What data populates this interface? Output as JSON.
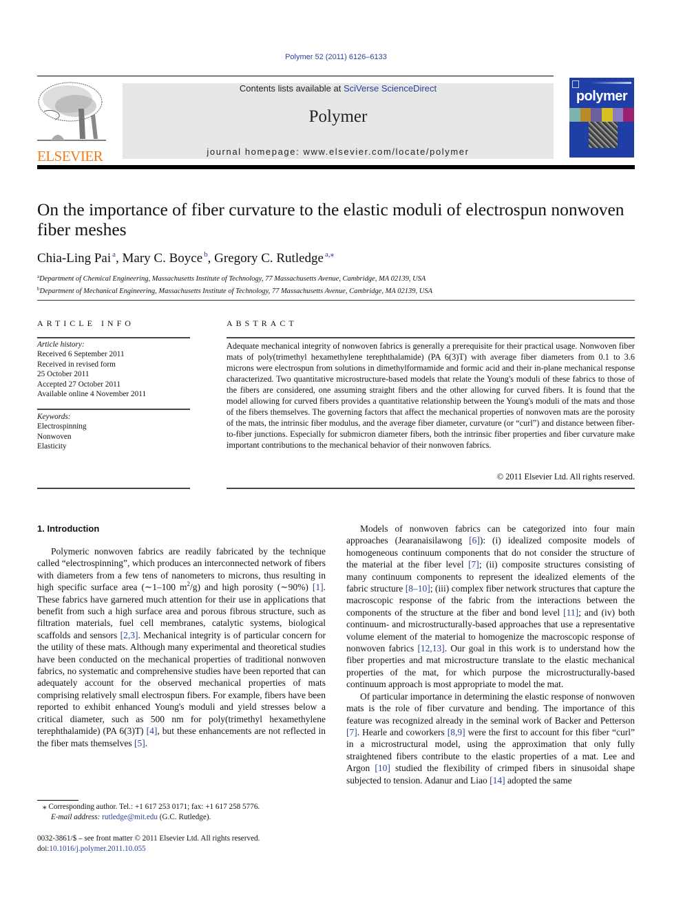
{
  "journal_ref": "Polymer 52 (2011) 6126–6133",
  "masthead": {
    "contents_prefix": "Contents lists available at ",
    "contents_link": "SciVerse ScienceDirect",
    "journal_name": "Polymer",
    "homepage": "journal homepage: www.elsevier.com/locate/polymer"
  },
  "publisher_logo": {
    "wordmark": "ELSEVIER",
    "color": "#f07c1a"
  },
  "cover": {
    "title": "polymer",
    "color": "#1f3fa7"
  },
  "article": {
    "title": "On the importance of fiber curvature to the elastic moduli of electrospun nonwoven fiber meshes",
    "authors": [
      {
        "name": "Chia-Ling Pai",
        "marks": "a"
      },
      {
        "name": "Mary C. Boyce",
        "marks": "b"
      },
      {
        "name": "Gregory C. Rutledge",
        "marks": "a,⁎"
      }
    ],
    "affiliations": [
      {
        "mark": "a",
        "text": "Department of Chemical Engineering, Massachusetts Institute of Technology, 77 Massachusetts Avenue, Cambridge, MA 02139, USA"
      },
      {
        "mark": "b",
        "text": "Department of Mechanical Engineering, Massachusetts Institute of Technology, 77 Massachusetts Avenue, Cambridge, MA 02139, USA"
      }
    ]
  },
  "article_info": {
    "heading": "ARTICLE INFO",
    "history_label": "Article history:",
    "history": [
      "Received 6 September 2011",
      "Received in revised form",
      "25 October 2011",
      "Accepted 27 October 2011",
      "Available online 4 November 2011"
    ],
    "keywords_label": "Keywords:",
    "keywords": [
      "Electrospinning",
      "Nonwoven",
      "Elasticity"
    ]
  },
  "abstract": {
    "heading": "ABSTRACT",
    "text": "Adequate mechanical integrity of nonwoven fabrics is generally a prerequisite for their practical usage. Nonwoven fiber mats of poly(trimethyl hexamethylene terephthalamide) (PA 6(3)T) with average fiber diameters from 0.1 to 3.6 microns were electrospun from solutions in dimethylformamide and formic acid and their in-plane mechanical response characterized. Two quantitative microstructure-based models that relate the Young's moduli of these fabrics to those of the fibers are considered, one assuming straight fibers and the other allowing for curved fibers. It is found that the model allowing for curved fibers provides a quantitative relationship between the Young's moduli of the mats and those of the fibers themselves. The governing factors that affect the mechanical properties of nonwoven mats are the porosity of the mats, the intrinsic fiber modulus, and the average fiber diameter, curvature (or “curl”) and distance between fiber-to-fiber junctions. Especially for submicron diameter fibers, both the intrinsic fiber properties and fiber curvature make important contributions to the mechanical behavior of their nonwoven fabrics.",
    "copyright": "© 2011 Elsevier Ltd. All rights reserved."
  },
  "introduction": {
    "heading": "1.  Introduction",
    "p1": [
      "Polymeric nonwoven fabrics are readily fabricated by the technique called “electrospinning”, which produces an interconnected network of fibers with diameters from a few tens of nanometers to microns, thus resulting in high specific surface area (∼1–100 m",
      "2",
      "/g) and high porosity (∼90%) ",
      "[1]",
      ". These fabrics have garnered much attention for their use in applications that benefit from such a high surface area and porous fibrous structure, such as filtration materials, fuel cell membranes, catalytic systems, biological scaffolds and sensors ",
      "[2,3]",
      ". Mechanical integrity is of particular concern for the utility of these mats. Although many experimental and theoretical studies have been conducted on the mechanical properties of traditional nonwoven fabrics, no systematic and comprehensive studies have been reported that can adequately account for the observed mechanical properties of mats comprising relatively small electrospun fibers. For example, fibers have been reported to exhibit enhanced Young's moduli and yield stresses below a critical diameter, such as 500 nm for poly(trimethyl hexamethylene terephthalamide) (PA 6(3)T) ",
      "[4]",
      ", but these enhancements are not reflected in the fiber mats themselves ",
      "[5]",
      "."
    ],
    "p2": [
      "Models of nonwoven fabrics can be categorized into four main approaches (Jearanaisilawong ",
      "[6]",
      "): (i) idealized composite models of homogeneous continuum components that do not consider the structure of the material at the fiber level ",
      "[7]",
      "; (ii) composite structures consisting of many continuum components to represent the idealized elements of the fabric structure ",
      "[8–10]",
      "; (iii) complex fiber network structures that capture the macroscopic response of the fabric from the interactions between the components of the structure at the fiber and bond level ",
      "[11]",
      "; and (iv) both continuum- and microstructurally-based approaches that use a representative volume element of the material to homogenize the macroscopic response of nonwoven fabrics ",
      "[12,13]",
      ". Our goal in this work is to understand how the fiber properties and mat microstructure translate to the elastic mechanical properties of the mat, for which purpose the microstructurally-based continuum approach is most appropriate to model the mat."
    ],
    "p3": [
      "Of particular importance in determining the elastic response of nonwoven mats is the role of fiber curvature and bending. The importance of this feature was recognized already in the seminal work of Backer and Petterson ",
      "[7]",
      ". Hearle and coworkers ",
      "[8,9]",
      " were the first to account for this fiber “curl” in a microstructural model, using the approximation that only fully straightened fibers contribute to the elastic properties of a mat. Lee and Argon ",
      "[10]",
      " studied the flexibility of crimped fibers in sinusoidal shape subjected to tension. Adanur and Liao ",
      "[14]",
      " adopted the same"
    ]
  },
  "footnote": {
    "corresponding": "⁎  Corresponding author. Tel.: +1 617 253 0171; fax: +1 617 258 5776.",
    "email_label": "E-mail address: ",
    "email": "rutledge@mit.edu",
    "email_suffix": " (G.C. Rutledge)."
  },
  "front_matter": {
    "issn_line": "0032-3861/$ – see front matter © 2011 Elsevier Ltd. All rights reserved.",
    "doi_prefix": "doi:",
    "doi": "10.1016/j.polymer.2011.10.055"
  }
}
